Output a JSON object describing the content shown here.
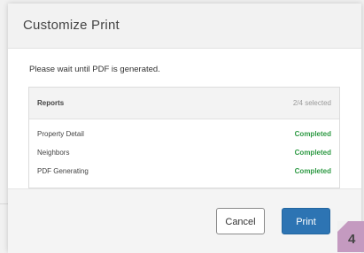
{
  "dialog": {
    "title": "Customize Print",
    "message": "Please wait until PDF is generated."
  },
  "reports": {
    "label": "Reports",
    "selected_count": "2/4 selected",
    "items": [
      {
        "name": "Property Detail",
        "status": "Completed"
      },
      {
        "name": "Neighbors",
        "status": "Completed"
      },
      {
        "name": "PDF Generating",
        "status": "Completed"
      }
    ]
  },
  "buttons": {
    "cancel_label": "Cancel",
    "print_label": "Print"
  },
  "step_badge": {
    "number": "4"
  },
  "colors": {
    "accent": "#2d74b3",
    "status_completed": "#2e9a44",
    "badge": "#c49ac0"
  }
}
